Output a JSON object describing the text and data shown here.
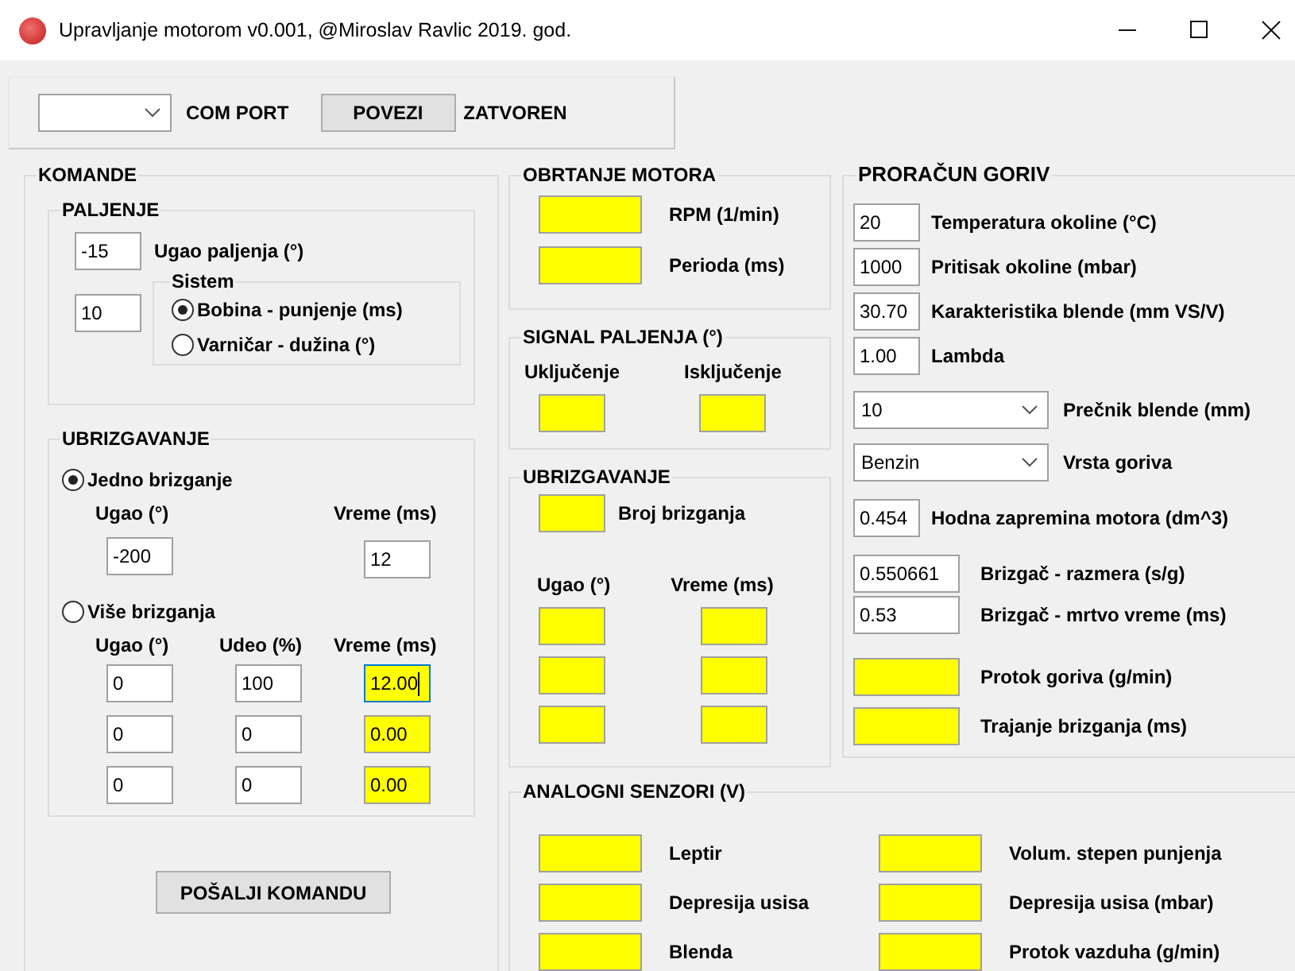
{
  "window": {
    "title": "Upravljanje motorom v0.001, @Miroslav Ravlic 2019. god."
  },
  "connection": {
    "port_label": "COM PORT",
    "connect_button": "POVEZI",
    "status": "ZATVOREN"
  },
  "commands": {
    "title": "KOMANDE",
    "ignition": {
      "title": "PALJENJE",
      "angle": {
        "value": "-15",
        "label": "Ugao paljenja (°)"
      },
      "system_value": "10",
      "system": {
        "title": "Sistem",
        "options": [
          {
            "label": "Bobina - punjenje (ms)",
            "selected": true
          },
          {
            "label": "Varničar - dužina (°)",
            "selected": false
          }
        ]
      }
    },
    "injection": {
      "title": "UBRIZGAVANJE",
      "modes": [
        {
          "label": "Jedno brizganje",
          "selected": true
        },
        {
          "label": "Više brizganja",
          "selected": false
        }
      ],
      "single": {
        "columns": [
          "Ugao (°)",
          "Vreme (ms)"
        ],
        "angle": "-200",
        "time": "12"
      },
      "multi": {
        "columns": [
          "Ugao (°)",
          "Udeo (%)",
          "Vreme (ms)"
        ],
        "rows": [
          {
            "angle": "0",
            "share": "100",
            "time": "12.00",
            "focused": true
          },
          {
            "angle": "0",
            "share": "0",
            "time": "0.00",
            "focused": false
          },
          {
            "angle": "0",
            "share": "0",
            "time": "0.00",
            "focused": false
          }
        ]
      }
    },
    "send_button": "POŠALJI KOMANDU"
  },
  "engine_speed": {
    "title": "OBRTANJE MOTORA",
    "readouts": [
      "RPM (1/min)",
      "Perioda (ms)"
    ]
  },
  "ignition_signal": {
    "title": "SIGNAL PALJENJA (°)",
    "columns": [
      "Uključenje",
      "Isključenje"
    ]
  },
  "injection_readout": {
    "title": "UBRIZGAVANJE",
    "count_label": "Broj brizganja",
    "columns": [
      "Ugao (°)",
      "Vreme (ms)"
    ]
  },
  "fuel": {
    "title": "PRORAČUN GORIV",
    "params": [
      {
        "kind": "input",
        "value": "20",
        "label": "Temperatura okoline (°C)"
      },
      {
        "kind": "input",
        "value": "1000",
        "label": "Pritisak okoline (mbar)"
      },
      {
        "kind": "input",
        "value": "30.70",
        "label": "Karakteristika blende (mm VS/V)"
      },
      {
        "kind": "input",
        "value": "1.00",
        "label": "Lambda"
      },
      {
        "kind": "dropdown",
        "value": "10",
        "label": "Prečnik blende (mm)"
      },
      {
        "kind": "dropdown",
        "value": "Benzin",
        "label": "Vrsta goriva"
      },
      {
        "kind": "input",
        "value": "0.454",
        "label": "Hodna zapremina motora (dm^3)"
      },
      {
        "kind": "wide",
        "value": "0.550661",
        "label": "Brizgač - razmera (s/g)"
      },
      {
        "kind": "wide",
        "value": "0.53",
        "label": "Brizgač - mrtvo vreme (ms)"
      },
      {
        "kind": "output",
        "label": "Protok goriva (g/min)"
      },
      {
        "kind": "output",
        "label": "Trajanje brizganja (ms)"
      }
    ]
  },
  "analog": {
    "title": "ANALOGNI SENZORI (V)",
    "sensors": [
      "Leptir",
      "Depresija usisa",
      "Blenda",
      "Volum. stepen punjenja",
      "Depresija usisa (mbar)",
      "Protok vazduha (g/min)"
    ]
  }
}
